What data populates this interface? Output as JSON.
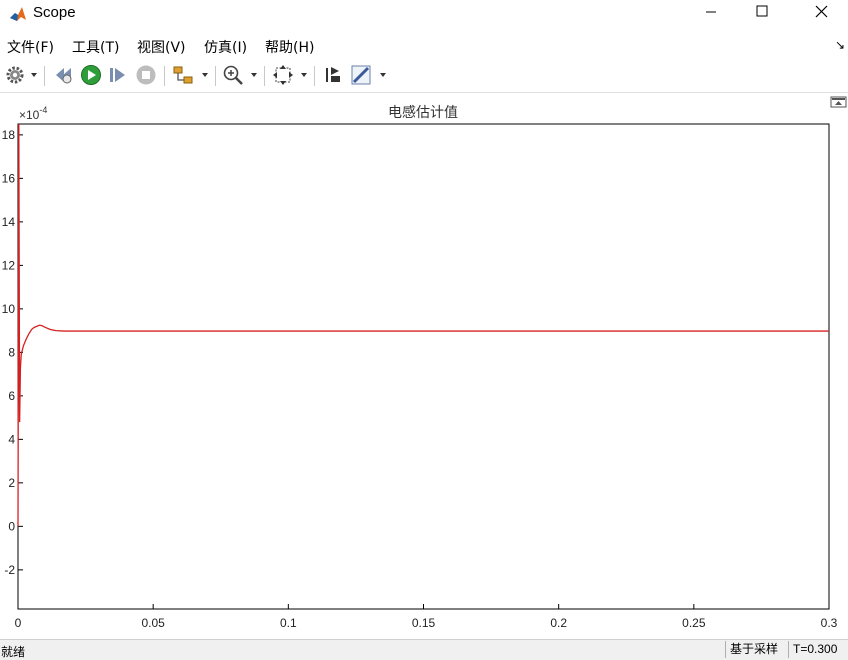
{
  "window": {
    "title": "Scope"
  },
  "menu": {
    "items": [
      "文件(F)",
      "工具(T)",
      "视图(V)",
      "仿真(I)",
      "帮助(H)"
    ]
  },
  "toolbar": {
    "icons": [
      "gear-icon",
      "step-back-icon",
      "run-icon",
      "step-forward-icon",
      "stop-icon",
      "signal-selector-icon",
      "zoom-in-icon",
      "fit-to-view-icon",
      "restore-axes-icon",
      "measurement-icon"
    ]
  },
  "status": {
    "left": "就绪",
    "mode": "基于采样",
    "time": "T=0.300"
  },
  "colors": {
    "trace": "#d62020",
    "grid": "#9a9a9a",
    "axes": "#000000"
  },
  "chart_data": {
    "type": "line",
    "title": "电感估计值",
    "exponent_label": "×10",
    "exponent_power": "-4",
    "xlabel": "",
    "ylabel": "",
    "xlim": [
      0,
      0.3
    ],
    "ylim": [
      -3.8,
      18.5
    ],
    "xticks": [
      0,
      0.05,
      0.1,
      0.15,
      0.2,
      0.25,
      0.3
    ],
    "xtick_labels": [
      "0",
      "0.05",
      "0.1",
      "0.15",
      "0.2",
      "0.25",
      "0.3"
    ],
    "yticks": [
      -2,
      0,
      2,
      4,
      6,
      8,
      10,
      12,
      14,
      16,
      18
    ],
    "ytick_labels": [
      "-2",
      "0",
      "2",
      "4",
      "6",
      "8",
      "10",
      "12",
      "14",
      "16",
      "18"
    ],
    "grid": true,
    "series": [
      {
        "x": [
          0,
          0.0003,
          0.0006,
          0.0009,
          0.0012,
          0.002,
          0.003,
          0.004,
          0.005,
          0.006,
          0.007,
          0.008,
          0.009,
          0.01,
          0.012,
          0.014,
          0.017,
          0.02,
          0.025,
          0.3
        ],
        "y": [
          0,
          18.5,
          4.8,
          7.3,
          7.9,
          8.3,
          8.6,
          8.85,
          9.05,
          9.15,
          9.2,
          9.25,
          9.22,
          9.15,
          9.05,
          9.0,
          8.98,
          8.98,
          8.98,
          8.98
        ]
      }
    ]
  }
}
